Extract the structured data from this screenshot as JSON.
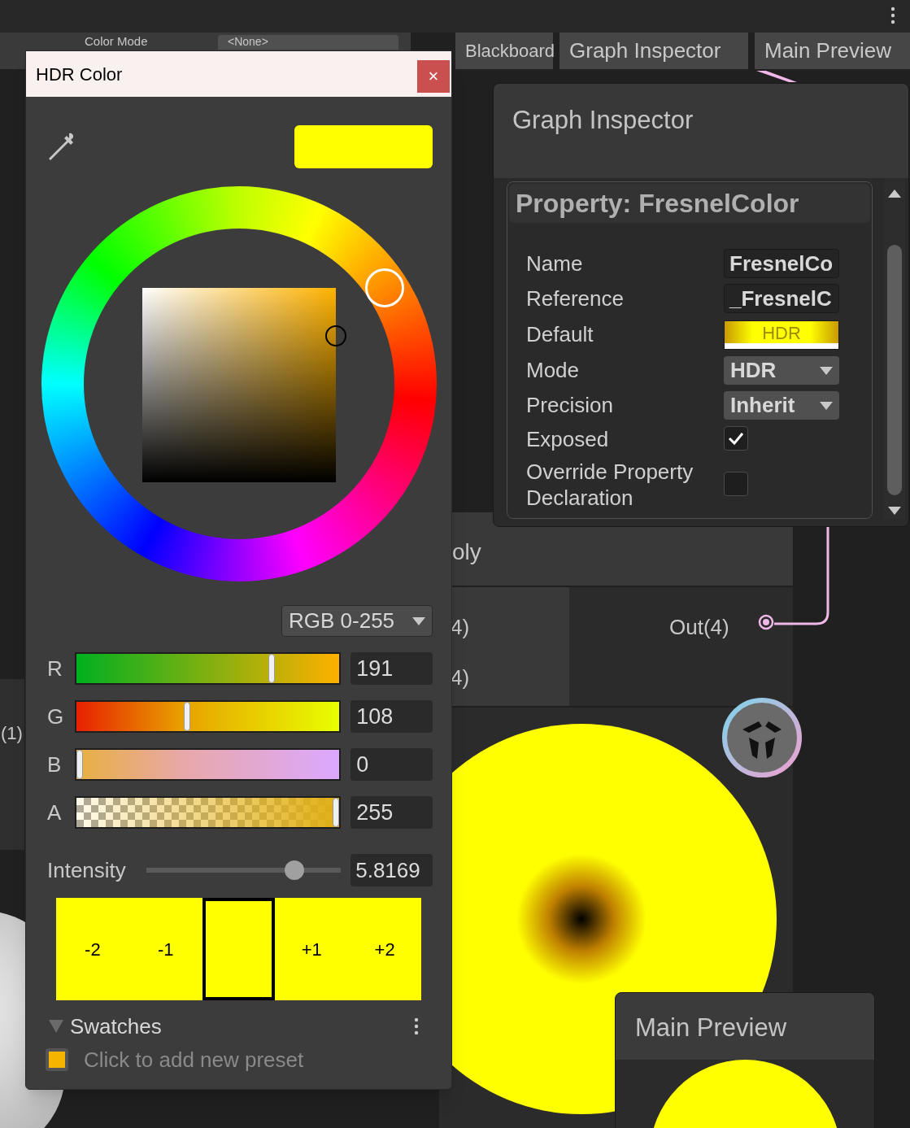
{
  "toolbar": {
    "color_mode_label": "Color Mode",
    "color_mode_value": "<None>"
  },
  "tabs": [
    {
      "label": "Blackboard",
      "selected": false
    },
    {
      "label": "Graph Inspector",
      "selected": false
    },
    {
      "label": "Main Preview",
      "selected": false
    }
  ],
  "node": {
    "title": "oly",
    "inputs": [
      "4)",
      "4)"
    ],
    "output": "Out(4)",
    "left_label": "(1)"
  },
  "graph_inspector": {
    "title": "Graph Inspector",
    "property_header": "Property: FresnelColor",
    "rows": [
      {
        "label": "Name",
        "kind": "text",
        "value": "FresnelCo"
      },
      {
        "label": "Reference",
        "kind": "text",
        "value": "_FresnelC"
      },
      {
        "label": "Default",
        "kind": "color",
        "value": "HDR"
      },
      {
        "label": "Mode",
        "kind": "dropdown",
        "value": "HDR"
      },
      {
        "label": "Precision",
        "kind": "dropdown",
        "value": "Inherit"
      },
      {
        "label": "Exposed",
        "kind": "checkbox",
        "checked": true
      },
      {
        "label": "Override Property Declaration",
        "kind": "checkbox",
        "checked": false
      }
    ]
  },
  "main_preview": {
    "title": "Main Preview"
  },
  "hdr_color_dialog": {
    "title": "HDR Color",
    "close": "×",
    "mode": "RGB 0-255",
    "channels": [
      {
        "label": "R",
        "kind": "r",
        "level": 0.75,
        "value": "191"
      },
      {
        "label": "G",
        "kind": "g",
        "level": 0.42,
        "value": "108"
      },
      {
        "label": "B",
        "kind": "b",
        "level": 0,
        "value": "0"
      },
      {
        "label": "A",
        "kind": "a",
        "level": 1,
        "value": "255"
      }
    ],
    "intensity": {
      "label": "Intensity",
      "level": 0.76,
      "value": "5.8169"
    },
    "intensity_stops": [
      {
        "label": "-2",
        "selected": false
      },
      {
        "label": "-1",
        "selected": false
      },
      {
        "selected": true
      },
      {
        "label": "+1",
        "selected": false
      },
      {
        "label": "+2",
        "selected": false
      }
    ],
    "swatches": {
      "label": "Swatches",
      "expanded": true,
      "preset_hint": "Click to add new preset"
    }
  }
}
